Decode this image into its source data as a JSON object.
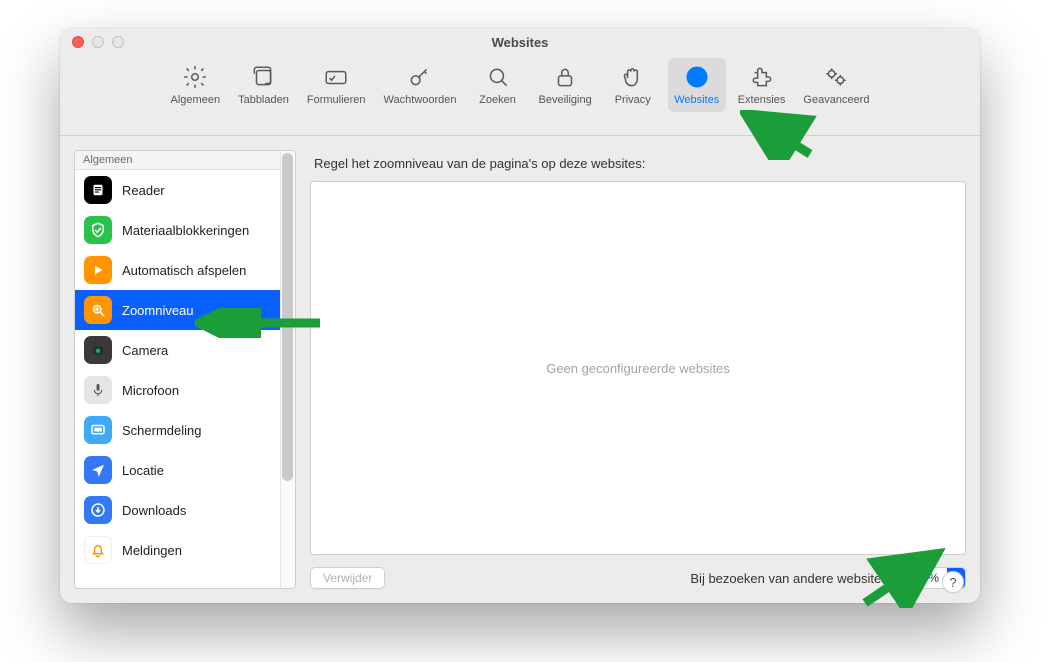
{
  "window": {
    "title": "Websites"
  },
  "toolbar": [
    {
      "id": "general",
      "label": "Algemeen"
    },
    {
      "id": "tabs",
      "label": "Tabbladen"
    },
    {
      "id": "forms",
      "label": "Formulieren"
    },
    {
      "id": "passwords",
      "label": "Wachtwoorden"
    },
    {
      "id": "search",
      "label": "Zoeken"
    },
    {
      "id": "security",
      "label": "Beveiliging"
    },
    {
      "id": "privacy",
      "label": "Privacy"
    },
    {
      "id": "websites",
      "label": "Websites",
      "active": true
    },
    {
      "id": "extensions",
      "label": "Extensies"
    },
    {
      "id": "advanced",
      "label": "Geavanceerd"
    }
  ],
  "sidebar": {
    "section_label": "Algemeen",
    "items": [
      {
        "id": "reader",
        "label": "Reader"
      },
      {
        "id": "mat",
        "label": "Materiaalblokkeringen"
      },
      {
        "id": "auto",
        "label": "Automatisch afspelen"
      },
      {
        "id": "zoom",
        "label": "Zoomniveau",
        "selected": true
      },
      {
        "id": "cam",
        "label": "Camera"
      },
      {
        "id": "mic",
        "label": "Microfoon"
      },
      {
        "id": "sd",
        "label": "Schermdeling"
      },
      {
        "id": "loc",
        "label": "Locatie"
      },
      {
        "id": "dl",
        "label": "Downloads"
      },
      {
        "id": "not",
        "label": "Meldingen"
      }
    ]
  },
  "panel": {
    "description": "Regel het zoomniveau van de pagina's op deze websites:",
    "empty_text": "Geen geconfigureerde websites",
    "delete_label": "Verwijder",
    "footer_label": "Bij bezoeken van andere websites:",
    "default_value": "100%"
  },
  "help_label": "?"
}
